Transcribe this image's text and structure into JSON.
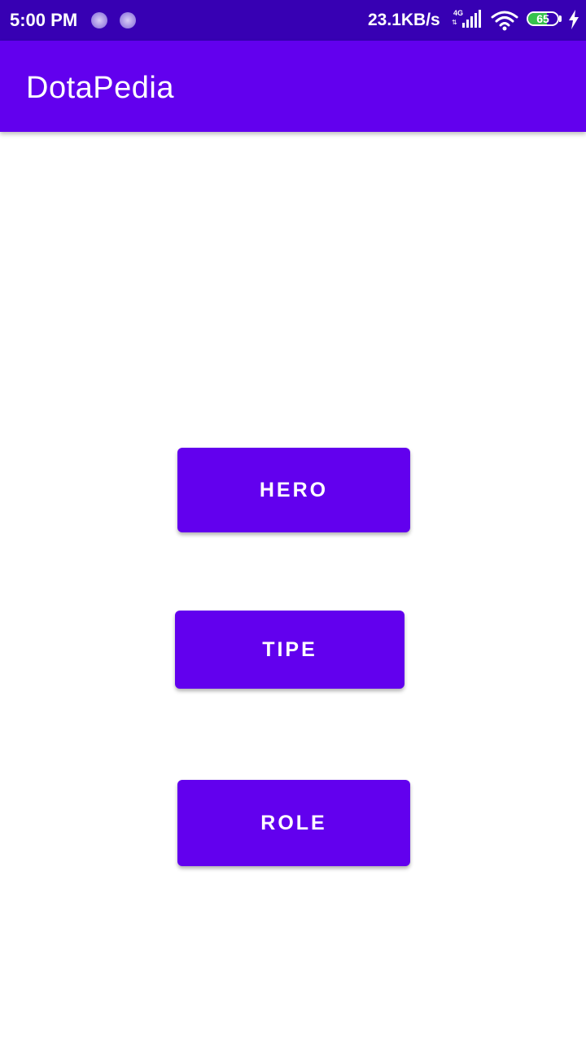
{
  "status_bar": {
    "time": "5:00 PM",
    "notification_icons": [
      "sync-icon",
      "sync-icon"
    ],
    "network_speed": "23.1KB/s",
    "signal_type": "4G",
    "battery_level": "65",
    "battery_fraction": 0.65,
    "charging": true
  },
  "app_bar": {
    "title": "DotaPedia"
  },
  "menu": {
    "hero_label": "HERO",
    "tipe_label": "TIPE",
    "role_label": "ROLE"
  },
  "colors": {
    "status_bar": "#3700b3",
    "primary": "#6200ee",
    "on_primary": "#ffffff",
    "background": "#ffffff",
    "battery_fill": "#36c24c"
  }
}
